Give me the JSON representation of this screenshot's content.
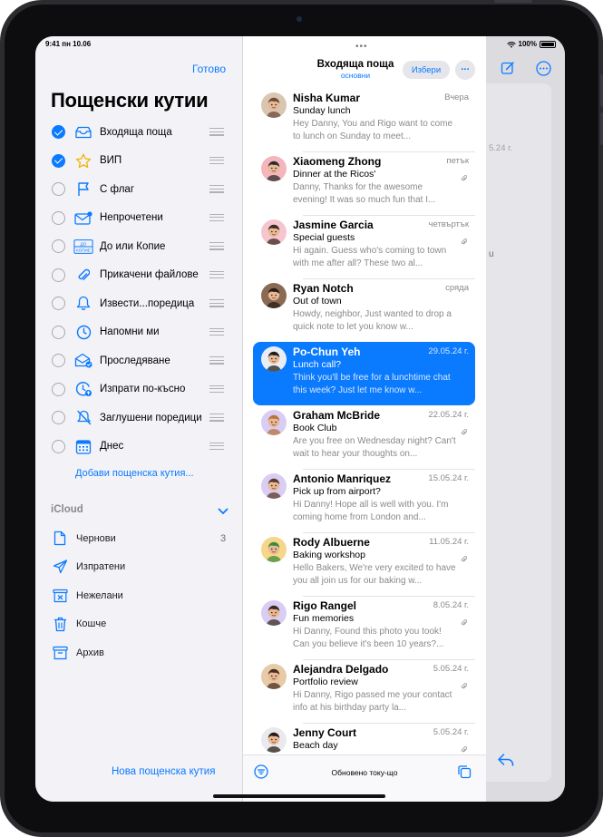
{
  "status": {
    "time_date": "9:41  пн 10.06",
    "battery": "100%"
  },
  "sidebar": {
    "done_label": "Готово",
    "title": "Пощенски кутии",
    "mailboxes": [
      {
        "label": "Входяща поща",
        "checked": true,
        "icon": "inbox-tray-icon"
      },
      {
        "label": "ВИП",
        "checked": true,
        "icon": "star-icon"
      },
      {
        "label": "С флаг",
        "checked": false,
        "icon": "flag-icon"
      },
      {
        "label": "Непрочетени",
        "checked": false,
        "icon": "unread-envelope-icon"
      },
      {
        "label": "До или Копие",
        "checked": false,
        "icon": "to-cc-icon"
      },
      {
        "label": "Прикачени файлове",
        "checked": false,
        "icon": "paperclip-icon"
      },
      {
        "label": "Извести...поредица",
        "checked": false,
        "icon": "bell-icon"
      },
      {
        "label": "Напомни ми",
        "checked": false,
        "icon": "clock-icon"
      },
      {
        "label": "Проследяване",
        "checked": false,
        "icon": "follow-up-envelope-icon"
      },
      {
        "label": "Изпрати по-късно",
        "checked": false,
        "icon": "send-later-icon"
      },
      {
        "label": "Заглушени поредици",
        "checked": false,
        "icon": "muted-bell-icon"
      },
      {
        "label": "Днес",
        "checked": false,
        "icon": "calendar-icon"
      }
    ],
    "add_mailbox_label": "Добави пощенска кутия...",
    "icloud": {
      "header": "iCloud",
      "items": [
        {
          "label": "Чернови",
          "count": "3",
          "icon": "draft-document-icon"
        },
        {
          "label": "Изпратени",
          "count": "",
          "icon": "paper-plane-icon"
        },
        {
          "label": "Нежелани",
          "count": "",
          "icon": "junk-box-icon"
        },
        {
          "label": "Кошче",
          "count": "",
          "icon": "trash-icon"
        },
        {
          "label": "Архив",
          "count": "",
          "icon": "archive-box-icon"
        }
      ]
    },
    "new_mailbox_label": "Нова пощенска кутия"
  },
  "list": {
    "title": "Входяща поща",
    "subtitle": "основни",
    "select_label": "Избери",
    "more_label": "···",
    "messages": [
      {
        "sender": "Nisha Kumar",
        "date": "Вчера",
        "subject": "Sunday lunch",
        "preview": "Hey Danny, You and Rigo want to come to lunch on Sunday to meet...",
        "attachment": false,
        "selected": false,
        "avatar_color": "#d9c6b0",
        "avatar_fg": "#6b4a3a"
      },
      {
        "sender": "Xiaomeng Zhong",
        "date": "петък",
        "subject": "Dinner at the Ricos'",
        "preview": "Danny, Thanks for the awesome evening! It was so much fun that I...",
        "attachment": true,
        "selected": false,
        "avatar_color": "#f4b5bd",
        "avatar_fg": "#2c2c2c"
      },
      {
        "sender": "Jasmine Garcia",
        "date": "четвъртък",
        "subject": "Special guests",
        "preview": "Hi again. Guess who's coming to town with me after all? These two al...",
        "attachment": true,
        "selected": false,
        "avatar_color": "#f6c6cf",
        "avatar_fg": "#3a2a22"
      },
      {
        "sender": "Ryan Notch",
        "date": "сряда",
        "subject": "Out of town",
        "preview": "Howdy, neighbor, Just wanted to drop a quick note to let you know w...",
        "attachment": false,
        "selected": false,
        "avatar_color": "#8a6a52",
        "avatar_fg": "#2a1c14"
      },
      {
        "sender": "Po-Chun Yeh",
        "date": "29.05.24 г.",
        "subject": "Lunch call?",
        "preview": "Think you'll be free for a lunchtime chat this week? Just let me know w...",
        "attachment": false,
        "selected": true,
        "avatar_color": "#e9eef5",
        "avatar_fg": "#1e1e1e"
      },
      {
        "sender": "Graham McBride",
        "date": "22.05.24 г.",
        "subject": "Book Club",
        "preview": "Are you free on Wednesday night? Can't wait to hear your thoughts on...",
        "attachment": true,
        "selected": false,
        "avatar_color": "#d9cdf4",
        "avatar_fg": "#b8733d"
      },
      {
        "sender": "Antonio Manriquez",
        "date": "15.05.24 г.",
        "subject": "Pick up from airport?",
        "preview": "Hi Danny! Hope all is well with you. I'm coming home from London and...",
        "attachment": false,
        "selected": false,
        "avatar_color": "#d9cdf4",
        "avatar_fg": "#5a3b2a"
      },
      {
        "sender": "Rody Albuerne",
        "date": "11.05.24 г.",
        "subject": "Baking workshop",
        "preview": "Hello Bakers, We're very excited to have you all join us for our baking w...",
        "attachment": true,
        "selected": false,
        "avatar_color": "#f6d68a",
        "avatar_fg": "#3a8c3a"
      },
      {
        "sender": "Rigo Rangel",
        "date": "8.05.24 г.",
        "subject": "Fun memories",
        "preview": "Hi Danny, Found this photo you took! Can you believe it's been 10 years?...",
        "attachment": true,
        "selected": false,
        "avatar_color": "#d9cdf4",
        "avatar_fg": "#3a2a22"
      },
      {
        "sender": "Alejandra Delgado",
        "date": "5.05.24 г.",
        "subject": "Portfolio review",
        "preview": "Hi Danny, Rigo passed me your contact info at his birthday party la...",
        "attachment": true,
        "selected": false,
        "avatar_color": "#e7cba8",
        "avatar_fg": "#4a2e20"
      },
      {
        "sender": "Jenny Court",
        "date": "5.05.24 г.",
        "subject": "Beach day",
        "preview": "",
        "attachment": true,
        "selected": false,
        "avatar_color": "#e9e9ee",
        "avatar_fg": "#2a1c14"
      }
    ],
    "updated_label": "Обновено току-що"
  },
  "detail": {
    "partial_date": "5.24 г.",
    "partial_text": "u"
  },
  "colors": {
    "accent": "#0a7aff",
    "sidebar_bg": "#f2f2f7",
    "selection": "#0a7aff"
  }
}
